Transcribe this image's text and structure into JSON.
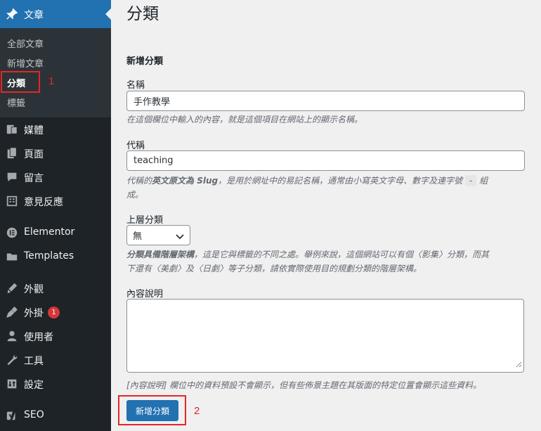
{
  "sidebar": {
    "posts_label": "文章",
    "submenu": [
      "全部文章",
      "新增文章",
      "分類",
      "標籤"
    ],
    "items": [
      {
        "label": "媒體",
        "icon": "media-icon"
      },
      {
        "label": "頁面",
        "icon": "pages-icon"
      },
      {
        "label": "留言",
        "icon": "comments-icon"
      },
      {
        "label": "意見反應",
        "icon": "feedback-icon"
      },
      {
        "label": "Elementor",
        "icon": "elementor-icon"
      },
      {
        "label": "Templates",
        "icon": "folder-icon"
      },
      {
        "label": "外觀",
        "icon": "appearance-icon"
      },
      {
        "label": "外掛",
        "icon": "plugins-icon",
        "badge": "1"
      },
      {
        "label": "使用者",
        "icon": "users-icon"
      },
      {
        "label": "工具",
        "icon": "tools-icon"
      },
      {
        "label": "設定",
        "icon": "settings-icon"
      },
      {
        "label": "SEO",
        "icon": "yoast-icon"
      }
    ]
  },
  "annotations": {
    "one": "1",
    "two": "2"
  },
  "main": {
    "page_title": "分類",
    "section_title": "新增分類",
    "name_label": "名稱",
    "name_value": "手作教學",
    "name_desc": "在這個欄位中輸入的內容，就是這個項目在網站上的顯示名稱。",
    "slug_label": "代稱",
    "slug_value": "teaching",
    "slug_desc_a": "代稱的",
    "slug_desc_b": "英文原文為 Slug",
    "slug_desc_c": "，是用於網址中的易記名稱，通常由小寫英文字母、數字及連字號",
    "slug_desc_code": "-",
    "slug_desc_d": "組",
    "slug_desc_e": "成。",
    "parent_label": "上層分類",
    "parent_value": "無",
    "parent_desc_a": "分類具備階層架構",
    "parent_desc_b": "，這是它與標籤的不同之處。舉例來說，這個網站可以有個〈影集〉分類，而其",
    "parent_desc_c": "下還有〈美劇〉及〈日劇〉等子分類，請依實際使用目的規劃分類的階層架構。",
    "description_label": "內容說明",
    "description_desc": "[內容說明] 欄位中的資料預設不會顯示，但有些佈景主題在其版面的特定位置會顯示這些資料。",
    "submit_label": "新增分類"
  },
  "colors": {
    "sidebar_bg": "#1d2327",
    "accent": "#2271b1",
    "annotation": "#e32626"
  }
}
